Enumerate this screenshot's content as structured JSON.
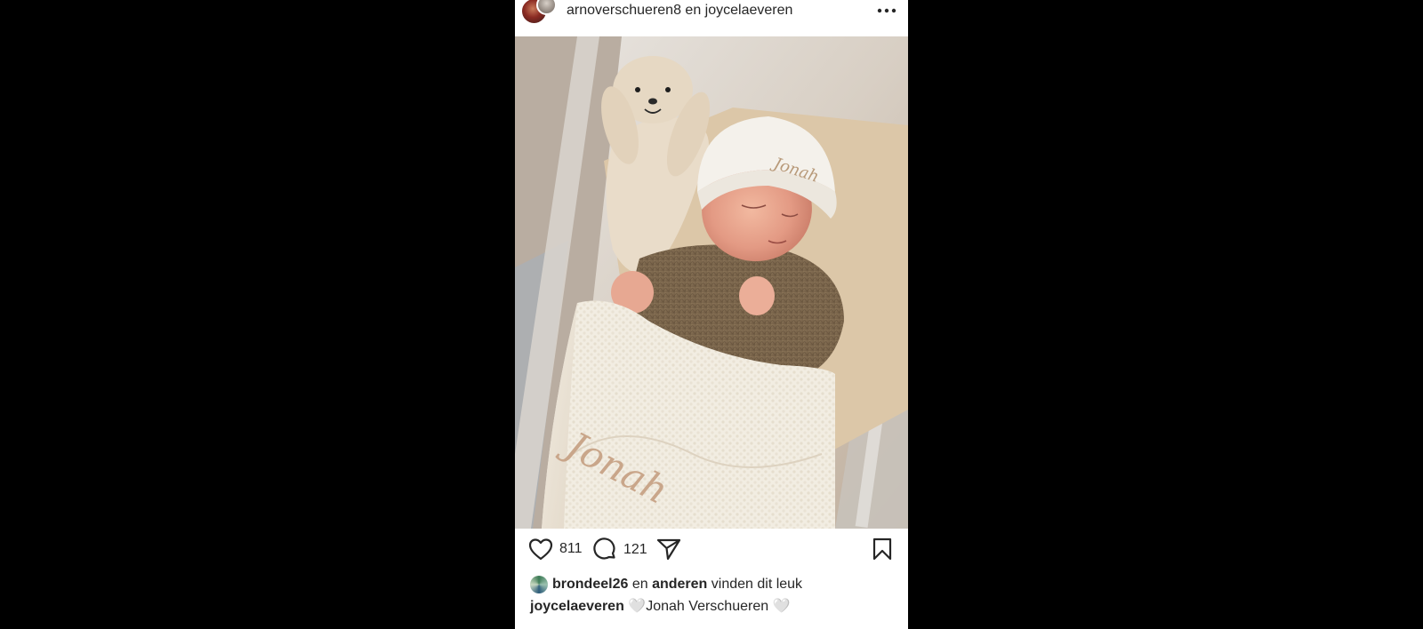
{
  "header": {
    "user1": "arnoverschueren8",
    "conjunction": "en",
    "user2": "joycelaeveren",
    "more_icon": "more-horizontal-icon"
  },
  "photo": {
    "embroidered_name_hat": "Jonah",
    "embroidered_name_blanket": "Jonah"
  },
  "actions": {
    "like_icon": "heart-icon",
    "like_count": "811",
    "comment_icon": "comment-icon",
    "comment_count": "121",
    "share_icon": "send-icon",
    "save_icon": "bookmark-icon"
  },
  "likes": {
    "first_liker": "brondeel26",
    "conjunction": "en",
    "others": "anderen",
    "suffix": "vinden dit leuk"
  },
  "caption": {
    "author": "joycelaeveren",
    "text": "🤍Jonah Verschueren 🤍"
  },
  "colors": {
    "background": "#000000",
    "post_background": "#ffffff",
    "text": "#262626"
  }
}
